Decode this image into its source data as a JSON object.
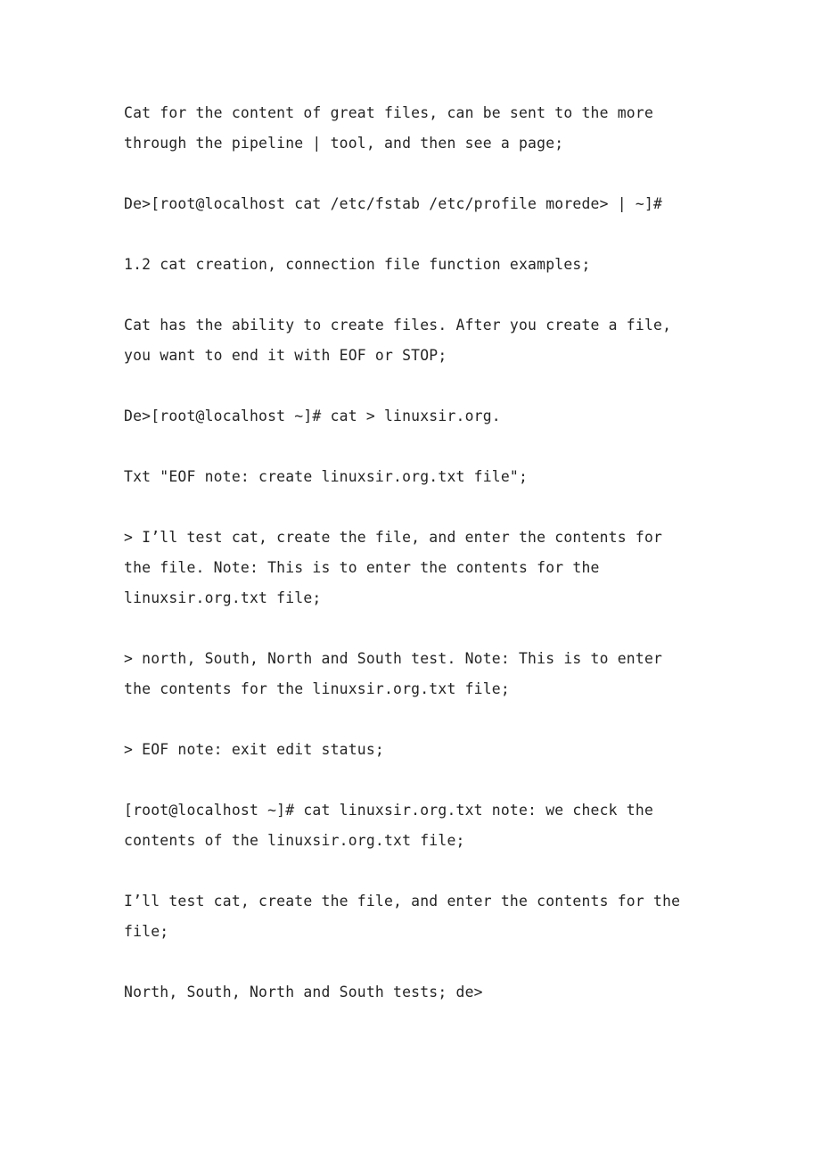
{
  "document": {
    "page_background": "#ffffff",
    "text_color": "#252525",
    "paragraphs": [
      {
        "id": "p1",
        "name": "paragraph-cat-more-pipe",
        "text": "Cat for the content of great files, can be sent to the more through the pipeline | tool, and then see a page;"
      },
      {
        "id": "p2",
        "name": "paragraph-command-cat-fstab-profile",
        "text": "De>[root@localhost cat /etc/fstab /etc/profile morede> | ~]#"
      },
      {
        "id": "p3",
        "name": "paragraph-heading-1-2",
        "text": "1.2 cat creation, connection file function examples;"
      },
      {
        "id": "p4",
        "name": "paragraph-cat-create-ability",
        "text": "Cat has the ability to create files. After you create a file, you want to end it with EOF or STOP;"
      },
      {
        "id": "p5",
        "name": "paragraph-command-cat-redirect",
        "text": "De>[root@localhost ~]# cat > linuxsir.org."
      },
      {
        "id": "p6",
        "name": "paragraph-txt-eof-note",
        "text": "Txt \"EOF note: create linuxsir.org.txt file\";"
      },
      {
        "id": "p7",
        "name": "paragraph-input-line-ill-test-cat",
        "text": "> I’ll test cat, create the file, and enter the contents for the file. Note: This is to enter the contents for the linuxsir.org.txt file;"
      },
      {
        "id": "p8",
        "name": "paragraph-input-line-north-south",
        "text": "> north, South, North and South test. Note: This is to enter the contents for the linuxsir.org.txt file;"
      },
      {
        "id": "p9",
        "name": "paragraph-input-line-eof-note",
        "text": "> EOF note: exit edit status;"
      },
      {
        "id": "p10",
        "name": "paragraph-command-cat-check-contents",
        "text": "[root@localhost ~]# cat linuxsir.org.txt note: we check the contents of the linuxsir.org.txt file;"
      },
      {
        "id": "p11",
        "name": "paragraph-output-ill-test-cat",
        "text": "I’ll test cat, create the file, and enter the contents for the file;"
      },
      {
        "id": "p12",
        "name": "paragraph-output-north-south-tests",
        "text": "North, South, North and South tests; de>"
      }
    ]
  }
}
